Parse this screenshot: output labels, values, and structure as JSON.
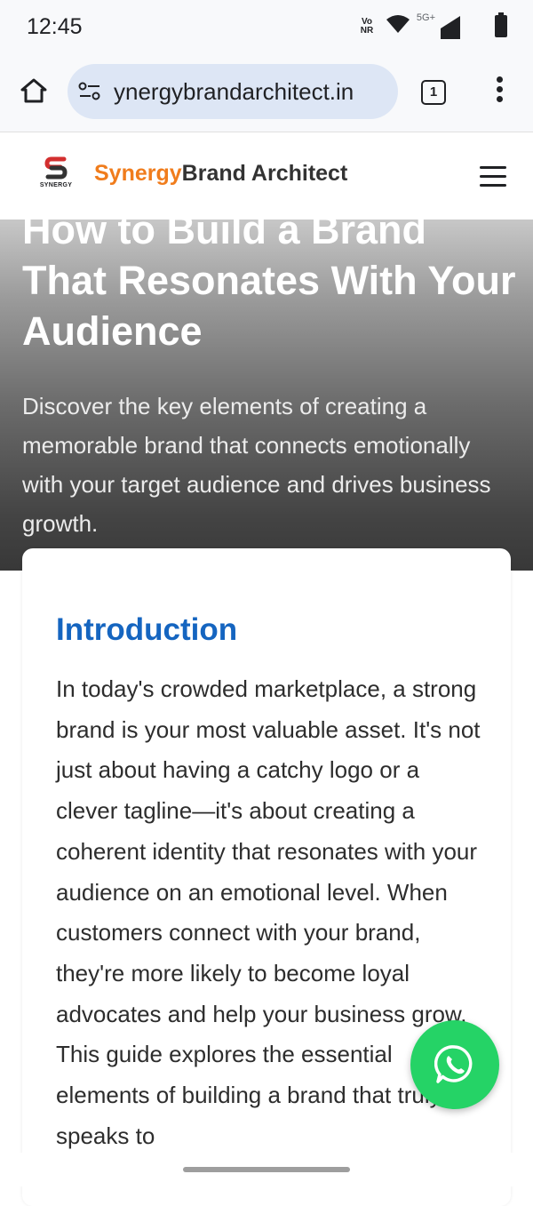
{
  "status_bar": {
    "time": "12:45",
    "volte_top": "Vo",
    "volte_bottom": "NR",
    "network": "5G+",
    "icons": [
      "wifi-icon",
      "signal-icon",
      "battery-icon"
    ]
  },
  "browser": {
    "url": "ynergybrandarchitect.in",
    "tab_count": "1",
    "icons": [
      "home-icon",
      "tune-icon",
      "more-vert-icon"
    ]
  },
  "site": {
    "logo_text": "SYNERGY",
    "brand_first": "Synergy",
    "brand_second": "Brand Architect",
    "colors": {
      "brand_orange": "#f07c1c",
      "heading_blue": "#1565c0",
      "whatsapp_green": "#25d366"
    }
  },
  "hero": {
    "title": "How to Build a Brand That Resonates With Your Audience",
    "subtitle": "Discover the key elements of creating a memorable brand that connects emotionally with your target audience and drives business growth."
  },
  "article": {
    "heading": "Introduction",
    "body": "In today's crowded marketplace, a strong brand is your most valuable asset. It's not just about having a catchy logo or a clever tagline—it's about creating a coherent identity that resonates with your audience on an emotional level. When customers connect with your brand, they're more likely to become loyal advocates and help your business grow. This guide explores the essential elements of building a brand that truly speaks to"
  }
}
